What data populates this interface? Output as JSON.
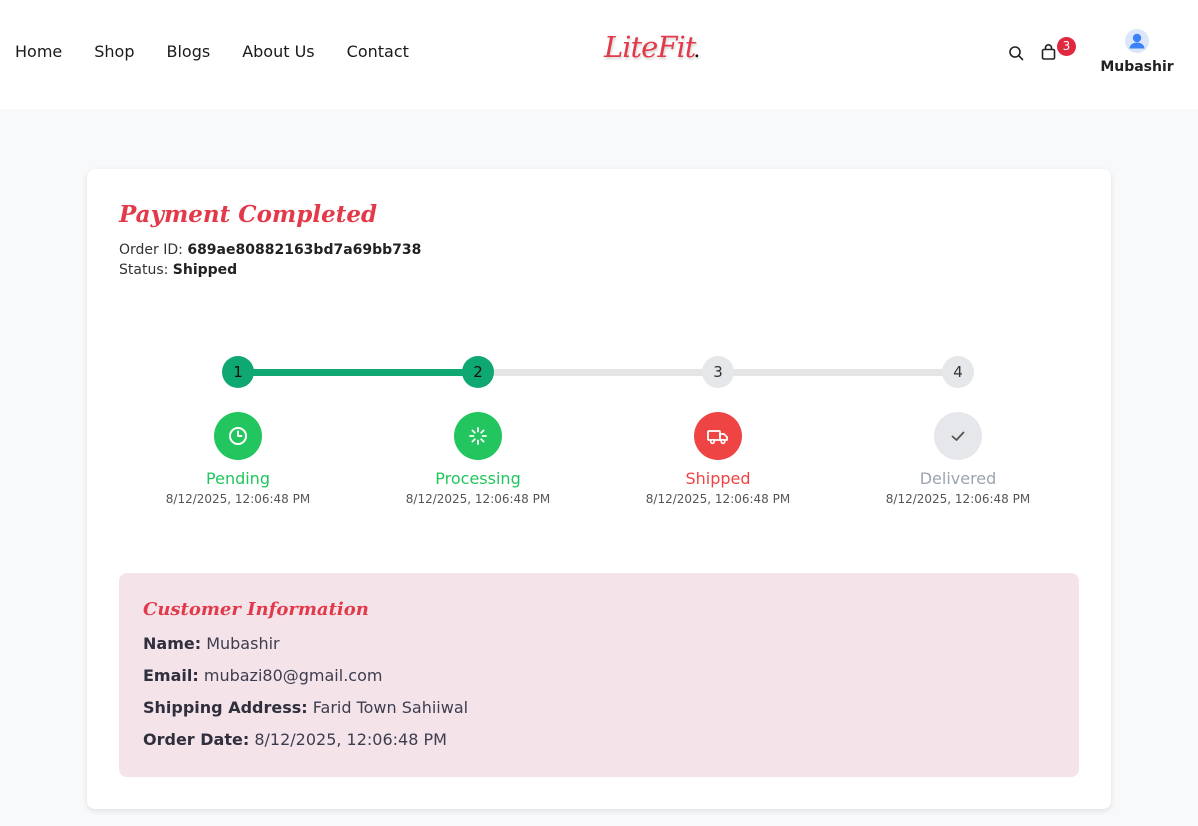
{
  "nav": {
    "items": [
      "Home",
      "Shop",
      "Blogs",
      "About Us",
      "Contact"
    ]
  },
  "brand": {
    "logo_text": "LiteFit",
    "logo_dot": "."
  },
  "header": {
    "cart_count": "3",
    "user_name": "Mubashir"
  },
  "order": {
    "title": "Payment Completed",
    "order_id_label": "Order ID:",
    "order_id": "689ae80882163bd7a69bb738",
    "status_label": "Status:",
    "status": "Shipped"
  },
  "steps": [
    {
      "number": "1",
      "label": "Pending",
      "date": "8/12/2025, 12:06:48 PM",
      "icon": "clock-icon",
      "color": "#22c55e",
      "label_color": "#22c55e"
    },
    {
      "number": "2",
      "label": "Processing",
      "date": "8/12/2025, 12:06:48 PM",
      "icon": "spinner-icon",
      "color": "#22c55e",
      "label_color": "#22c55e"
    },
    {
      "number": "3",
      "label": "Shipped",
      "date": "8/12/2025, 12:06:48 PM",
      "icon": "truck-icon",
      "color": "#ef4444",
      "label_color": "#ef4444"
    },
    {
      "number": "4",
      "label": "Delivered",
      "date": "8/12/2025, 12:06:48 PM",
      "icon": "check-icon",
      "color": "#e6e7ea",
      "label_color": "#9ca3af"
    }
  ],
  "progress": {
    "completed_steps": 2,
    "track_color": "#0fa872"
  },
  "customer": {
    "title": "Customer Information",
    "name_label": "Name:",
    "name": "Mubashir",
    "email_label": "Email:",
    "email": "mubazi80@gmail.com",
    "address_label": "Shipping Address:",
    "address": "Farid Town Sahiiwal",
    "date_label": "Order Date:",
    "date": "8/12/2025, 12:06:48 PM"
  },
  "colors": {
    "accent": "#e23a4a",
    "success": "#0fa872",
    "info_bg": "#f4e4ea"
  }
}
